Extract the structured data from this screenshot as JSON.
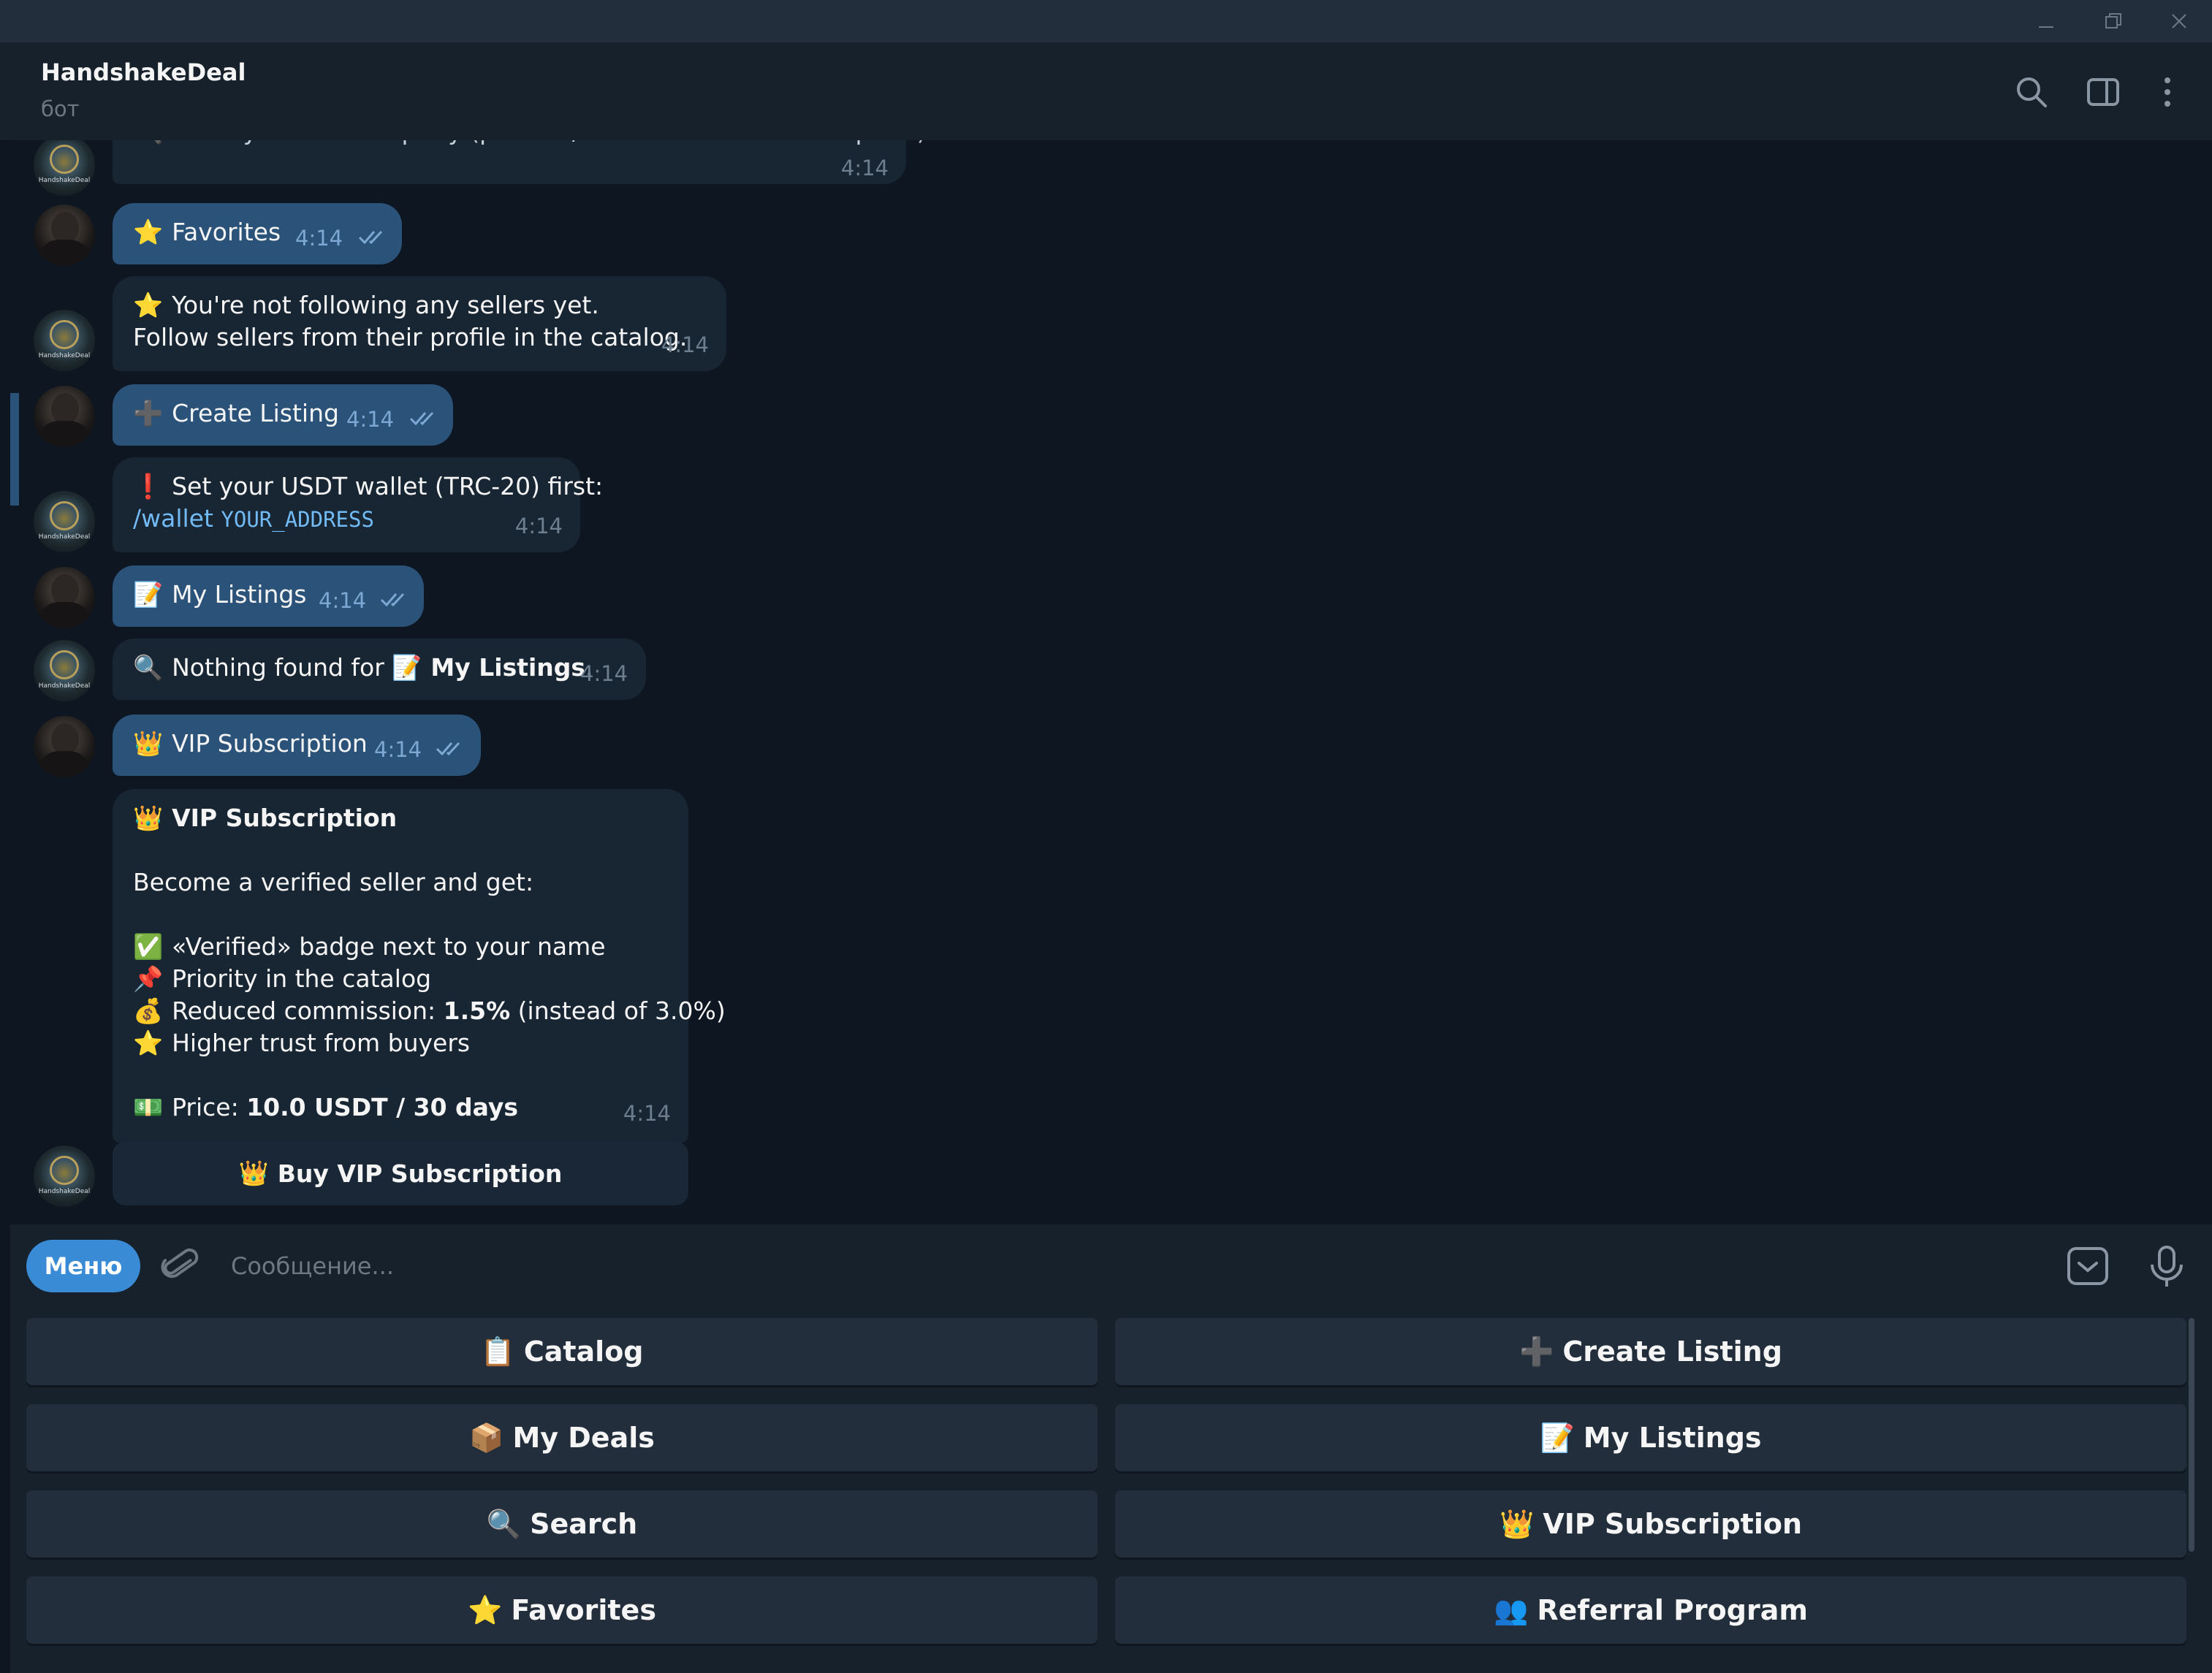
{
  "window": {
    "controls": [
      "minimize",
      "restore",
      "close"
    ]
  },
  "header": {
    "title": "HandshakeDeal",
    "subtitle": "бот"
  },
  "avatars": {
    "bot_label": "HandshakeDeal"
  },
  "messages": {
    "m0": {
      "text": "🔍 Enter your search query (product/service name or description):",
      "time": "4:14"
    },
    "m1": {
      "emoji": "⭐",
      "text": "Favorites",
      "time": "4:14"
    },
    "m2": {
      "line1_emoji": "⭐",
      "line1": "You're not following any sellers yet.",
      "line2": "Follow sellers from their profile in the catalog.",
      "time": "4:14"
    },
    "m3": {
      "emoji": "➕",
      "text": "Create Listing",
      "time": "4:14"
    },
    "m4": {
      "emoji": "❗",
      "line1": "Set your USDT wallet (TRC-20) first:",
      "cmd": "/wallet",
      "arg": "YOUR_ADDRESS",
      "time": "4:14"
    },
    "m5": {
      "emoji": "📝",
      "text": "My Listings",
      "time": "4:14"
    },
    "m6": {
      "emoji": "🔍",
      "text": "Nothing found for",
      "emoji2": "📝",
      "bold": "My Listings",
      "suffix": ".",
      "time": "4:14"
    },
    "m7": {
      "emoji": "👑",
      "text": "VIP Subscription",
      "time": "4:14"
    },
    "m8": {
      "title_emoji": "👑",
      "title": "VIP Subscription",
      "intro": "Become a verified seller and get:",
      "b1_emoji": "✅",
      "b1": "«Verified» badge next to your name",
      "b2_emoji": "📌",
      "b2": "Priority in the catalog",
      "b3_emoji": "💰",
      "b3_pre": "Reduced commission: ",
      "b3_bold": "1.5%",
      "b3_post": " (instead of 3.0%)",
      "b4_emoji": "⭐",
      "b4": "Higher trust from buyers",
      "price_emoji": "💵",
      "price_pre": "Price: ",
      "price_bold": "10.0 USDT / 30 days",
      "time": "4:14"
    },
    "inline_button": {
      "emoji": "👑",
      "label": "Buy VIP Subscription"
    }
  },
  "composer": {
    "menu_label": "Меню",
    "placeholder": "Сообщение..."
  },
  "keyboard": {
    "rows": [
      [
        {
          "emoji": "📋",
          "label": "Catalog"
        },
        {
          "emoji": "➕",
          "label": "Create Listing"
        }
      ],
      [
        {
          "emoji": "📦",
          "label": "My Deals"
        },
        {
          "emoji": "📝",
          "label": "My Listings"
        }
      ],
      [
        {
          "emoji": "🔍",
          "label": "Search"
        },
        {
          "emoji": "👑",
          "label": "VIP Subscription"
        }
      ],
      [
        {
          "emoji": "⭐",
          "label": "Favorites"
        },
        {
          "emoji": "👥",
          "label": "Referral Program"
        }
      ]
    ]
  },
  "colors": {
    "background": "#0e1621",
    "incoming_bubble": "#182533",
    "outgoing_bubble": "#2b5278",
    "accent": "#3a8bd6",
    "link": "#71baf4"
  }
}
